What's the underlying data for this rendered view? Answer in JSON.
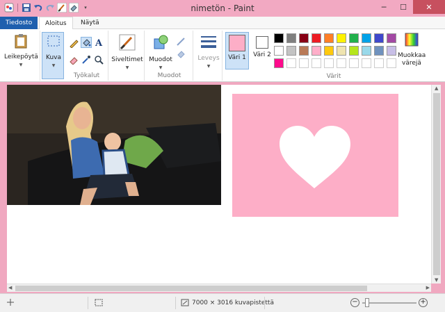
{
  "window": {
    "title": "nimetön - Paint",
    "minimize_glyph": "─",
    "maximize_glyph": "☐",
    "close_glyph": "✕"
  },
  "tabs": [
    {
      "label": "Tiedosto"
    },
    {
      "label": "Aloitus"
    },
    {
      "label": "Näytä"
    }
  ],
  "ribbon": {
    "clipboard": {
      "label": "Leikepöytä"
    },
    "image": {
      "label": "Kuva"
    },
    "tools": {
      "group_label": "Työkalut"
    },
    "brushes": {
      "label": "Siveltimet"
    },
    "shapes": {
      "label": "Muodot",
      "group_label": "Muodot"
    },
    "size": {
      "label": "Leveys"
    },
    "color1": {
      "label": "Väri 1",
      "color": "#fdaec7"
    },
    "color2": {
      "label": "Väri 2",
      "color": "#ffffff"
    },
    "palette": {
      "group_label": "Värit",
      "row1": [
        "#000000",
        "#7f7f7f",
        "#880015",
        "#ed1c24",
        "#ff7f27",
        "#fff200",
        "#22b14c",
        "#00a2e8",
        "#3f48cc",
        "#a349a4"
      ],
      "row2": [
        "#ffffff",
        "#c3c3c3",
        "#b97a57",
        "#ffaec9",
        "#ffc90e",
        "#efe4b0",
        "#b5e61d",
        "#99d9ea",
        "#7092be",
        "#c8bfe7"
      ],
      "row3": [
        "#ff0a8c",
        "",
        "",
        "",
        "",
        "",
        "",
        "",
        "",
        ""
      ]
    },
    "edit_colors": {
      "label": "Muokkaa värejä"
    }
  },
  "statusbar": {
    "image_size": "7000 × 3016 kuvapistettä"
  },
  "colors": {
    "titlebar": "#f2a9c2",
    "file_tab": "#1e5fae",
    "pink_card": "#fdaec7"
  }
}
